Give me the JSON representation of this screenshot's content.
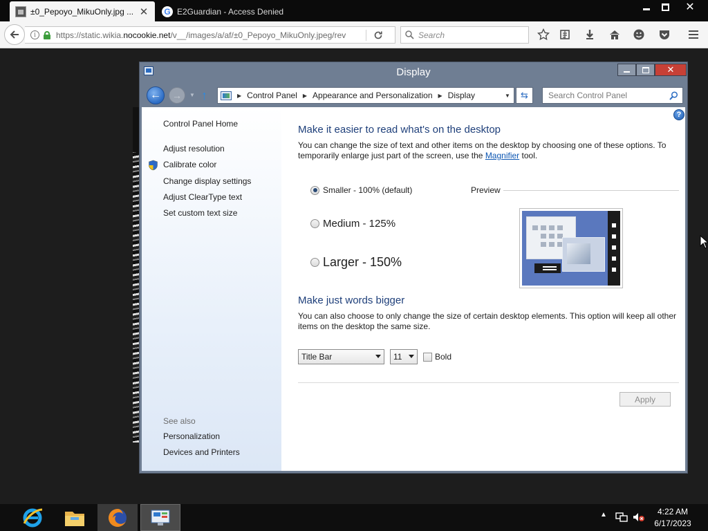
{
  "browser": {
    "tabs": [
      {
        "title": "±0_Pepoyo_MikuOnly.jpg ...",
        "active": true
      },
      {
        "title": "E2Guardian - Access Denied",
        "active": false
      }
    ],
    "url": {
      "prefix": "https://static.wikia.",
      "host": "nocookie.net",
      "path": "/v__/images/a/af/±0_Pepoyo_MikuOnly.jpeg/rev"
    },
    "search_placeholder": "Search",
    "toolbar_icons": [
      "star-icon",
      "reading-list-icon",
      "download-icon",
      "home-icon",
      "emoji-icon",
      "pocket-icon",
      "menu-icon"
    ]
  },
  "window": {
    "title": "Display",
    "breadcrumb": [
      "Control Panel",
      "Appearance and Personalization",
      "Display"
    ],
    "search_placeholder": "Search Control Panel"
  },
  "sidebar": {
    "home": "Control Panel Home",
    "links": [
      "Adjust resolution",
      "Calibrate color",
      "Change display settings",
      "Adjust ClearType text",
      "Set custom text size"
    ],
    "see_also_label": "See also",
    "see_also": [
      "Personalization",
      "Devices and Printers"
    ]
  },
  "main": {
    "heading1": "Make it easier to read what's on the desktop",
    "para1_before": "You can change the size of text and other items on the desktop by choosing one of these options. To temporarily enlarge just part of the screen, use the ",
    "para1_link": "Magnifier",
    "para1_after": " tool.",
    "size_options": [
      {
        "label": "Smaller - 100% (default)",
        "selected": true
      },
      {
        "label": "Medium - 125%",
        "selected": false
      },
      {
        "label": "Larger - 150%",
        "selected": false
      }
    ],
    "preview_label": "Preview",
    "heading2": "Make just words bigger",
    "para2": "You can also choose to only change the size of certain desktop elements. This option will keep all other items on the desktop the same size.",
    "element_select": "Title Bar",
    "size_select": "11",
    "bold_label": "Bold",
    "bold_checked": false,
    "apply_label": "Apply",
    "apply_enabled": false
  },
  "taskbar": {
    "pinned": [
      "internet-explorer-icon",
      "file-explorer-icon",
      "firefox-icon",
      "control-panel-icon"
    ],
    "time": "4:22 AM",
    "date": "6/17/2023"
  },
  "colors": {
    "heading": "#1e3f7a",
    "link": "#0b55b2",
    "close_button": "#c74036"
  }
}
